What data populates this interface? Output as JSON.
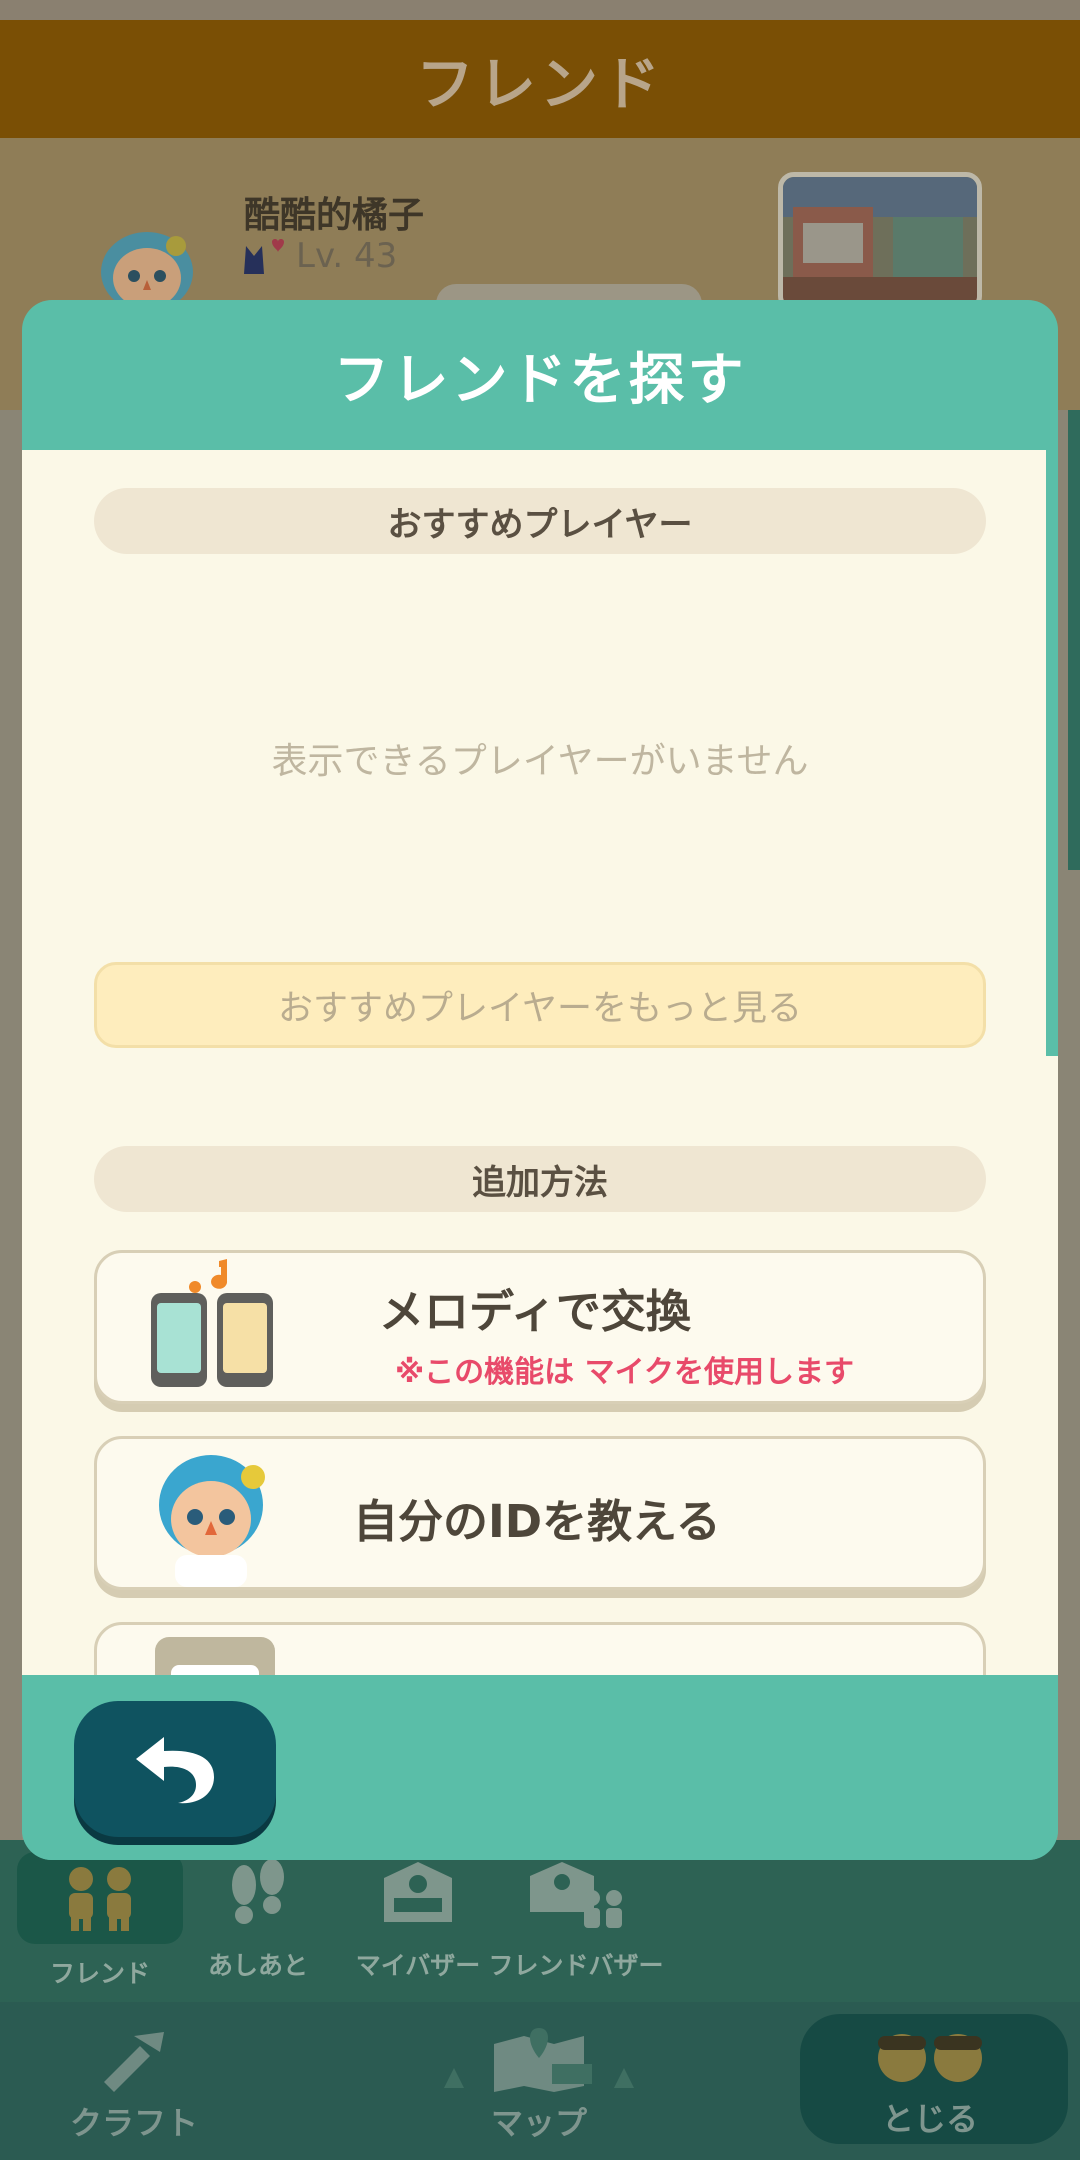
{
  "header": {
    "title": "フレンド"
  },
  "profile": {
    "name": "酷酷的橘子",
    "level": "Lv. 43"
  },
  "modal": {
    "title": "フレンドを探す",
    "recommended": {
      "header": "おすすめプレイヤー",
      "empty_message": "表示できるプレイヤーがいません",
      "more_button": "おすすめプレイヤーをもっと見る"
    },
    "add_methods": {
      "header": "追加方法",
      "options": [
        {
          "title": "メロディで交換",
          "note": "※この機能は マイクを使用します",
          "icon": "phones-music-icon"
        },
        {
          "title": "自分のIDを教える",
          "icon": "player-avatar-icon"
        },
        {
          "title": "",
          "icon": "id-card-icon"
        }
      ]
    },
    "back_icon": "back-arrow-icon"
  },
  "sub_tabs": [
    {
      "label": "フレンド",
      "icon": "friends-icon",
      "active": true
    },
    {
      "label": "あしあと",
      "icon": "footprints-icon",
      "active": false
    },
    {
      "label": "マイバザー",
      "icon": "bazaar-icon",
      "active": false
    },
    {
      "label": "フレンドバザー",
      "icon": "friend-bazaar-icon",
      "active": false
    }
  ],
  "main_nav": [
    {
      "label": "クラフト",
      "icon": "craft-icon"
    },
    {
      "label": "マップ",
      "icon": "map-icon"
    },
    {
      "label": "とじる",
      "icon": "close-friends-icon"
    }
  ],
  "colors": {
    "modal_teal": "#5abea8",
    "panel_cream": "#fbf8e7",
    "back_button": "#0f5360",
    "note_pink": "#e84a6a",
    "header_brown": "#7a4f05"
  }
}
